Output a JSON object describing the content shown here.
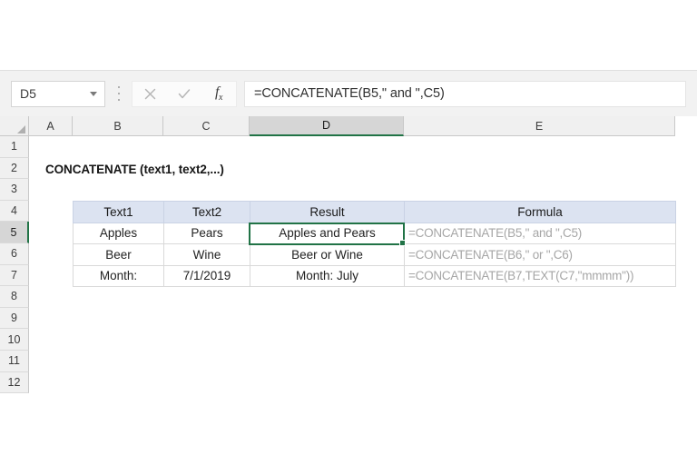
{
  "formula_bar": {
    "name_box_value": "D5",
    "name_box_placeholder": "Name Box",
    "cancel_icon": "close-icon",
    "enter_icon": "check-icon",
    "insert_function_icon": "fx-icon",
    "insert_function_label": "fx",
    "formula_value": "=CONCATENATE(B5,\" and \",C5)",
    "formula_placeholder": "Formula Bar"
  },
  "grid": {
    "columns": [
      "A",
      "B",
      "C",
      "D",
      "E"
    ],
    "active_column": "D",
    "rows": [
      "1",
      "2",
      "3",
      "4",
      "5",
      "6",
      "7",
      "8",
      "9",
      "10",
      "11",
      "12"
    ],
    "active_row": "5",
    "select_all_icon": "select-all-triangle-icon"
  },
  "sheet": {
    "title": "CONCATENATE (text1, text2,...)"
  },
  "table": {
    "headers": [
      "Text1",
      "Text2",
      "Result",
      "Formula"
    ],
    "rows": [
      {
        "text1": "Apples",
        "text2": "Pears",
        "result": "Apples and Pears",
        "formula": "=CONCATENATE(B5,\" and \",C5)"
      },
      {
        "text1": "Beer",
        "text2": "Wine",
        "result": "Beer or Wine",
        "formula": "=CONCATENATE(B6,\" or \",C6)"
      },
      {
        "text1": "Month:",
        "text2": "7/1/2019",
        "result": "Month: July",
        "formula": "=CONCATENATE(B7,TEXT(C7,\"mmmm\"))"
      }
    ]
  },
  "colors": {
    "excel_green": "#217346",
    "header_fill": "#dce3f1",
    "formula_text": "#a6a6a6",
    "chrome_gray": "#f2f2f2"
  }
}
